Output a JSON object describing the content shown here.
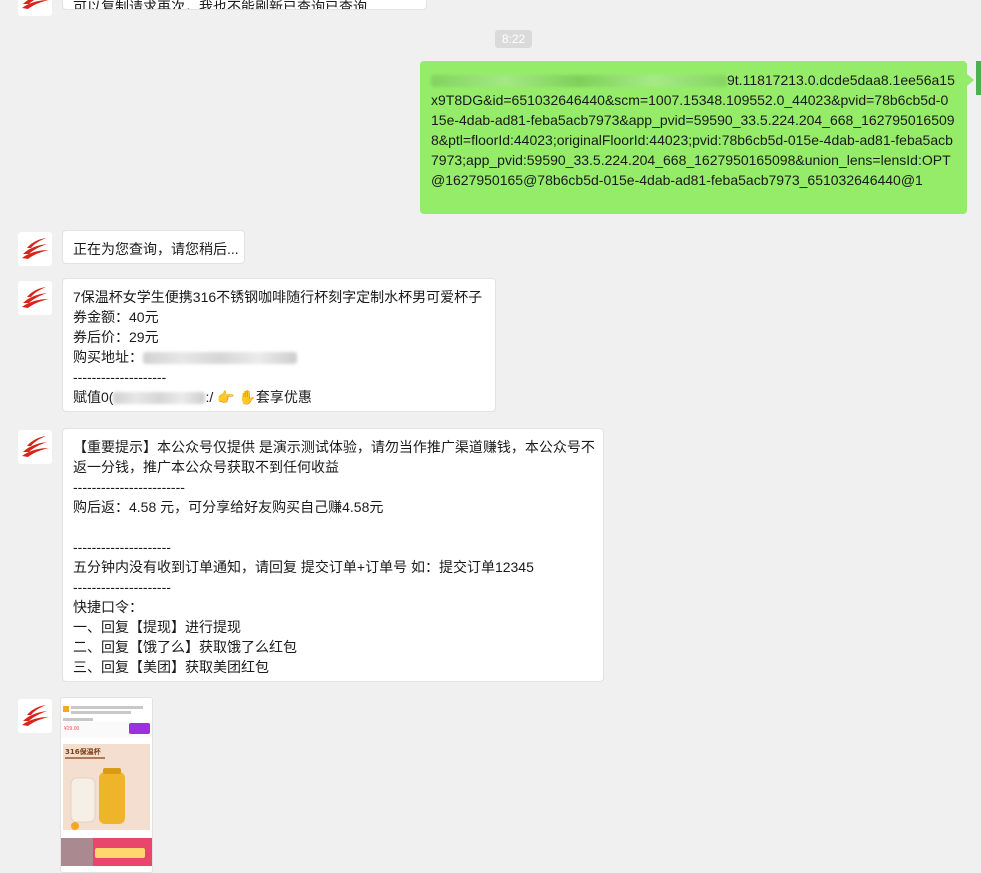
{
  "time_stamp": "8:22",
  "top_partial_text": "可以复制请求再次，我也不能刷新已查询已查询",
  "sent_link": {
    "visible_prefix": "9t.11817213.0.dcde5daa8.1ee56a15x9T8DG&id=651032646440&scm=1007.15348.109552.0_44023&pvid=78b6cb5d-015e-4dab-ad81-feba5acb7973&app_pvid=59590_33.5.224.204_668_1627950165098&ptl=floorId:44023;originalFloorId:44023;pvid:78b6cb5d-015e-4dab-ad81-feba5acb7973;app_pvid:59590_33.5.224.204_668_1627950165098&union_lens=lensId:OPT@1627950165@78b6cb5d-015e-4dab-ad81-feba5acb7973_651032646440@1"
  },
  "msg_querying": "正在为您查询，请您稍后...",
  "product_msg": {
    "title": "7保温杯女学生便携316不锈钢咖啡随行杯刻字定制水杯男可爱杯子",
    "coupon": "券金额：40元",
    "after_price": "券后价：29元",
    "buy_addr_label": "购买地址：",
    "divider": "--------------------",
    "copy_prefix": "赋值0(",
    "copy_suffix": ":/",
    "pointing_emoji": "👉",
    "hand_emoji": "✋",
    "enjoy": "套享优惠"
  },
  "notice_msg": {
    "line1": "【重要提示】本公众号仅提供 是演示测试体验，请勿当作推广渠道赚钱，本公众号不",
    "line2": "返一分钱，推广本公众号获取不到任何收益",
    "divider1": "------------------------",
    "rebate": "购后返：4.58 元，可分享给好友购买自己赚4.58元",
    "divider2": "---------------------",
    "order_tip": "五分钟内没有收到订单通知，请回复 提交订单+订单号 如：提交订单12345",
    "divider3": "---------------------",
    "shortcuts": "快捷口令：",
    "cmd1": "一、回复【提现】进行提现",
    "cmd2": "二、回复【饿了么】获取饿了么红包",
    "cmd3": "三、回复【美团】获取美团红包"
  },
  "poster": {
    "headline": "316保温杯",
    "price": "¥29.00",
    "colors": {
      "accent": "#9b30e0",
      "price": "#ff4d4f",
      "banner": "#e8466b"
    }
  },
  "colors": {
    "background": "#f0f0f0",
    "me_bubble": "#95ec69",
    "brand_red": "#d9241b"
  }
}
